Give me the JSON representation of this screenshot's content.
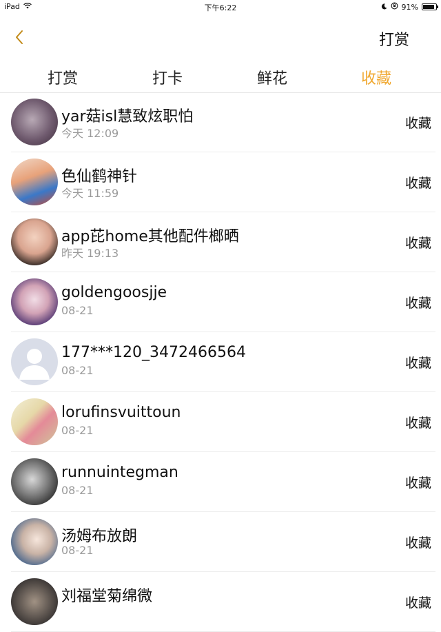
{
  "status_bar": {
    "device": "iPad",
    "time": "下午6:22",
    "battery": "91%",
    "battery_level": 0.91
  },
  "nav": {
    "title": "打赏",
    "back_icon": "chevron-left-icon",
    "accent_color": "#f0a830"
  },
  "tabs": [
    {
      "label": "打赏",
      "active": false
    },
    {
      "label": "打卡",
      "active": false
    },
    {
      "label": "鲜花",
      "active": false
    },
    {
      "label": "收藏",
      "active": true
    }
  ],
  "list": {
    "items": [
      {
        "name": "yar菇isl慧致炫职怕",
        "time": "今天 12:09",
        "action": "收藏"
      },
      {
        "name": "色仙鹤神针",
        "time": "今天 11:59",
        "action": "收藏"
      },
      {
        "name": "app芘home其他配件榔晒",
        "time": "昨天 19:13",
        "action": "收藏"
      },
      {
        "name": "goldengoosjje",
        "time": "08-21",
        "action": "收藏"
      },
      {
        "name": "177***120_3472466564",
        "time": "08-21",
        "action": "收藏"
      },
      {
        "name": "lorufinsvuittoun",
        "time": "08-21",
        "action": "收藏"
      },
      {
        "name": "runnuintegman",
        "time": "08-21",
        "action": "收藏"
      },
      {
        "name": "汤姆布放朗",
        "time": "08-21",
        "action": "收藏"
      },
      {
        "name": "刘福堂菊绵微",
        "time": "",
        "action": "收藏"
      }
    ]
  }
}
